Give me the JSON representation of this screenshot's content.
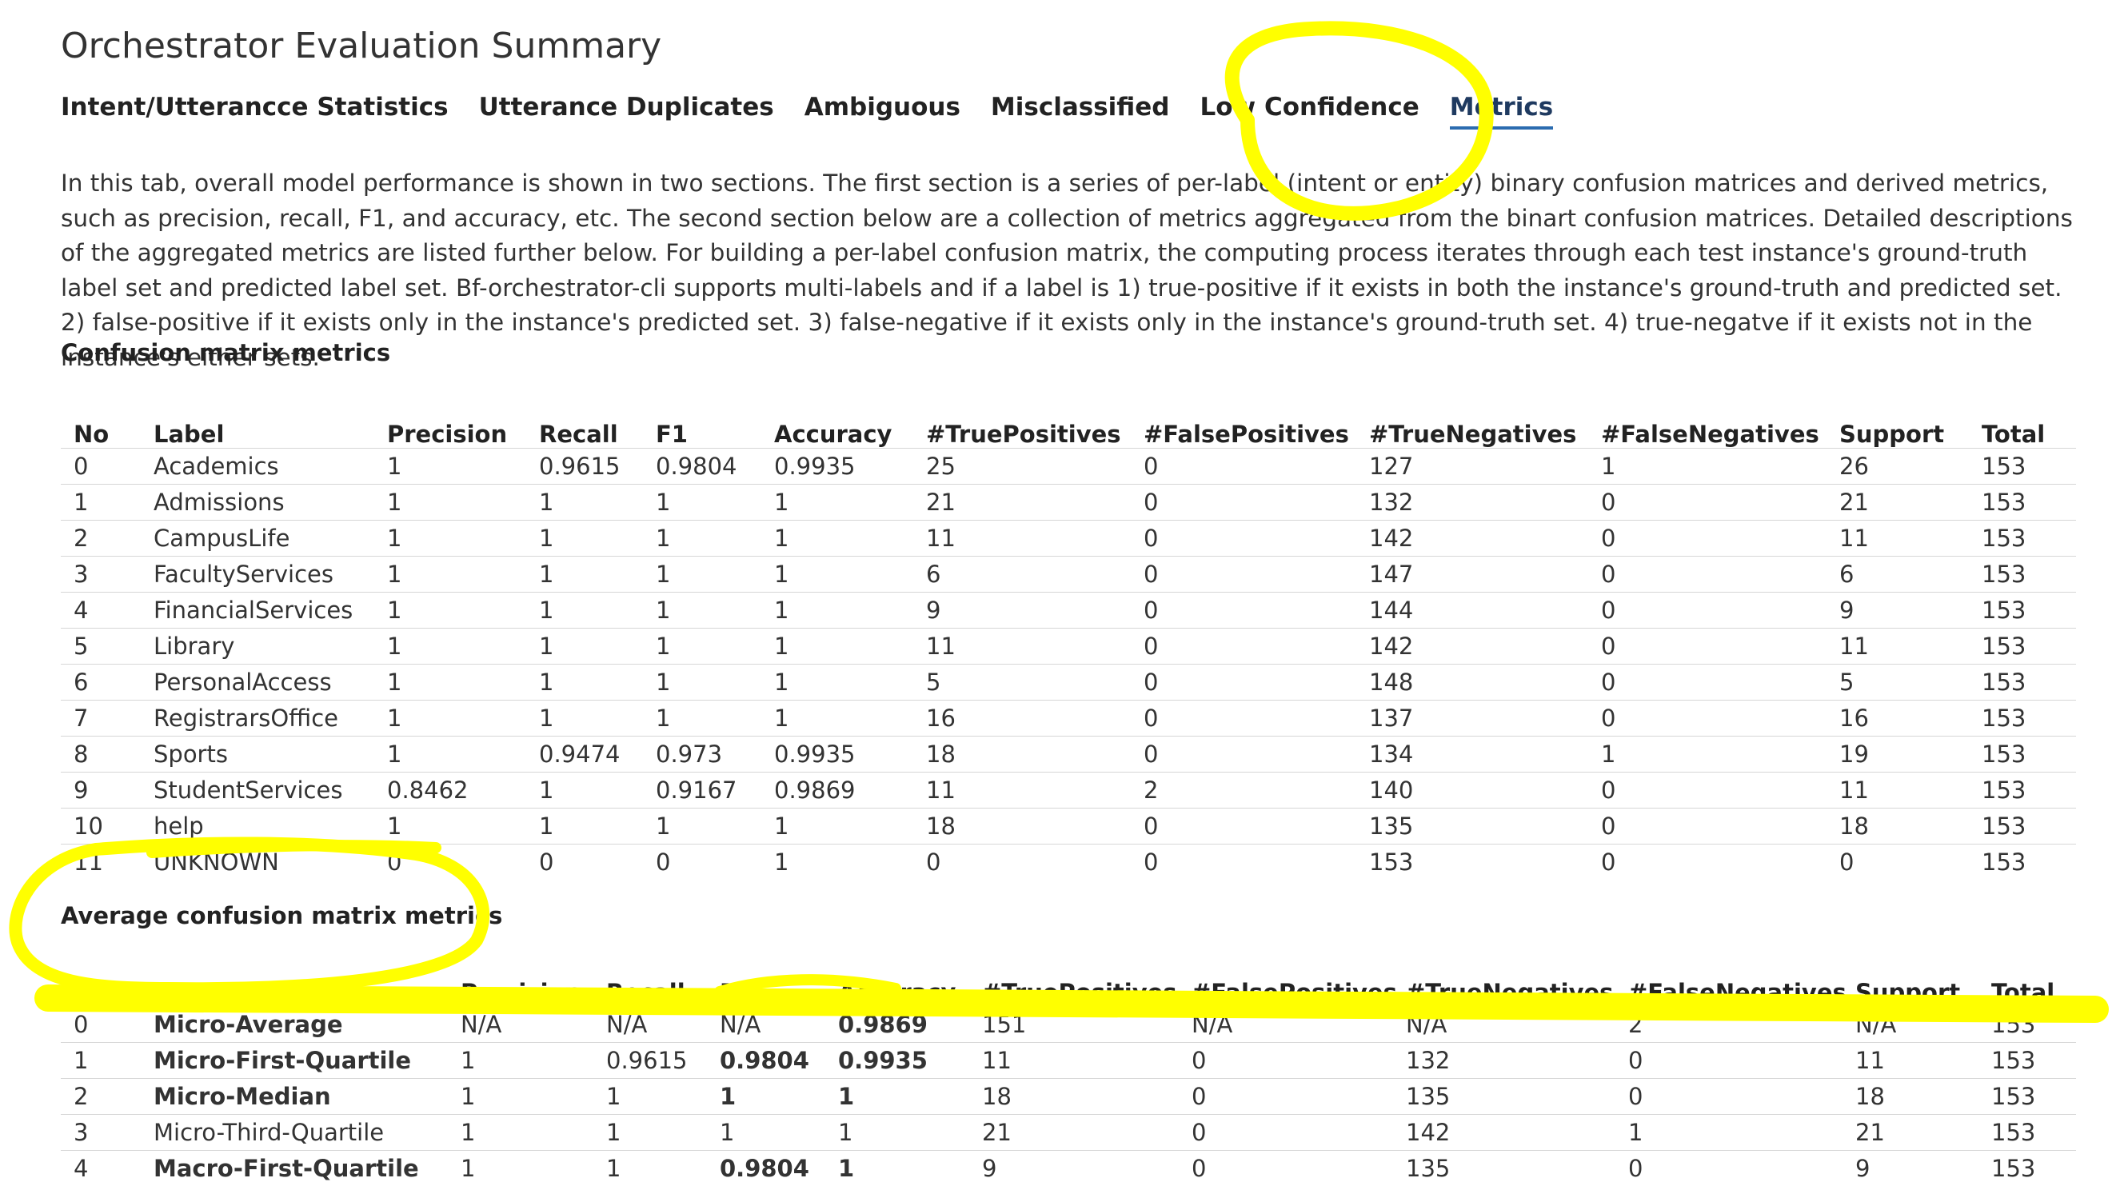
{
  "title": "Orchestrator Evaluation Summary",
  "tabs": [
    {
      "label": "Intent/Utterancce Statistics",
      "active": false
    },
    {
      "label": "Utterance Duplicates",
      "active": false
    },
    {
      "label": "Ambiguous",
      "active": false
    },
    {
      "label": "Misclassified",
      "active": false
    },
    {
      "label": "Low Confidence",
      "active": false
    },
    {
      "label": "Metrics",
      "active": true
    }
  ],
  "intro": "In this tab, overall model performance is shown in two sections. The first section is a series of per-label (intent or entity) binary confusion matrices and derived metrics, such as precision, recall, F1, and accuracy, etc. The second section below are a collection of metrics aggregated from the binart confusion matrices. Detailed descriptions of the aggregated metrics are listed further below. For building a per-label confusion matrix, the computing process iterates through each test instance's ground-truth label set and predicted label set. Bf-orchestrator-cli supports multi-labels and if a label is 1) true-positive if it exists in both the instance's ground-truth and predicted set. 2) false-positive if it exists only in the instance's predicted set. 3) false-negative if it exists only in the instance's ground-truth set. 4) true-negatve if it exists not in the instance's either sets.",
  "confusion": {
    "heading": "Confusion matrix metrics",
    "columns": [
      "No",
      "Label",
      "Precision",
      "Recall",
      "F1",
      "Accuracy",
      "#TruePositives",
      "#FalsePositives",
      "#TrueNegatives",
      "#FalseNegatives",
      "Support",
      "Total"
    ],
    "rows": [
      [
        "0",
        "Academics",
        "1",
        "0.9615",
        "0.9804",
        "0.9935",
        "25",
        "0",
        "127",
        "1",
        "26",
        "153"
      ],
      [
        "1",
        "Admissions",
        "1",
        "1",
        "1",
        "1",
        "21",
        "0",
        "132",
        "0",
        "21",
        "153"
      ],
      [
        "2",
        "CampusLife",
        "1",
        "1",
        "1",
        "1",
        "11",
        "0",
        "142",
        "0",
        "11",
        "153"
      ],
      [
        "3",
        "FacultyServices",
        "1",
        "1",
        "1",
        "1",
        "6",
        "0",
        "147",
        "0",
        "6",
        "153"
      ],
      [
        "4",
        "FinancialServices",
        "1",
        "1",
        "1",
        "1",
        "9",
        "0",
        "144",
        "0",
        "9",
        "153"
      ],
      [
        "5",
        "Library",
        "1",
        "1",
        "1",
        "1",
        "11",
        "0",
        "142",
        "0",
        "11",
        "153"
      ],
      [
        "6",
        "PersonalAccess",
        "1",
        "1",
        "1",
        "1",
        "5",
        "0",
        "148",
        "0",
        "5",
        "153"
      ],
      [
        "7",
        "RegistrarsOffice",
        "1",
        "1",
        "1",
        "1",
        "16",
        "0",
        "137",
        "0",
        "16",
        "153"
      ],
      [
        "8",
        "Sports",
        "1",
        "0.9474",
        "0.973",
        "0.9935",
        "18",
        "0",
        "134",
        "1",
        "19",
        "153"
      ],
      [
        "9",
        "StudentServices",
        "0.8462",
        "1",
        "0.9167",
        "0.9869",
        "11",
        "2",
        "140",
        "0",
        "11",
        "153"
      ],
      [
        "10",
        "help",
        "1",
        "1",
        "1",
        "1",
        "18",
        "0",
        "135",
        "0",
        "18",
        "153"
      ],
      [
        "11",
        "UNKNOWN",
        "0",
        "0",
        "0",
        "1",
        "0",
        "0",
        "153",
        "0",
        "0",
        "153"
      ]
    ]
  },
  "average": {
    "heading": "Average confusion matrix metrics",
    "columns": [
      "No",
      "Type",
      "Precision",
      "Recall",
      "F1",
      "Accuracy",
      "#TruePositives",
      "#FalsePositives",
      "#TrueNegatives",
      "#FalseNegatives",
      "Support",
      "Total"
    ],
    "rows": [
      [
        "0",
        "Micro-Average",
        "N/A",
        "N/A",
        "N/A",
        "0.9869",
        "151",
        "N/A",
        "N/A",
        "2",
        "N/A",
        "153"
      ],
      [
        "1",
        "Micro-First-Quartile",
        "1",
        "0.9615",
        "0.9804",
        "0.9935",
        "11",
        "0",
        "132",
        "0",
        "11",
        "153"
      ],
      [
        "2",
        "Micro-Median",
        "1",
        "1",
        "1",
        "1",
        "18",
        "0",
        "135",
        "0",
        "18",
        "153"
      ],
      [
        "3",
        "Micro-Third-Quartile",
        "1",
        "1",
        "1",
        "1",
        "21",
        "0",
        "142",
        "1",
        "21",
        "153"
      ],
      [
        "4",
        "Macro-First-Quartile",
        "1",
        "1",
        "0.9804",
        "1",
        "9",
        "0",
        "135",
        "0",
        "9",
        "153"
      ]
    ],
    "bold_cells": [
      [
        0,
        1
      ],
      [
        0,
        5
      ],
      [
        1,
        1
      ],
      [
        1,
        4
      ],
      [
        1,
        5
      ],
      [
        2,
        1
      ],
      [
        2,
        4
      ],
      [
        2,
        5
      ],
      [
        4,
        1
      ],
      [
        4,
        4
      ],
      [
        4,
        5
      ]
    ]
  },
  "highlight_color": "#ffff00"
}
